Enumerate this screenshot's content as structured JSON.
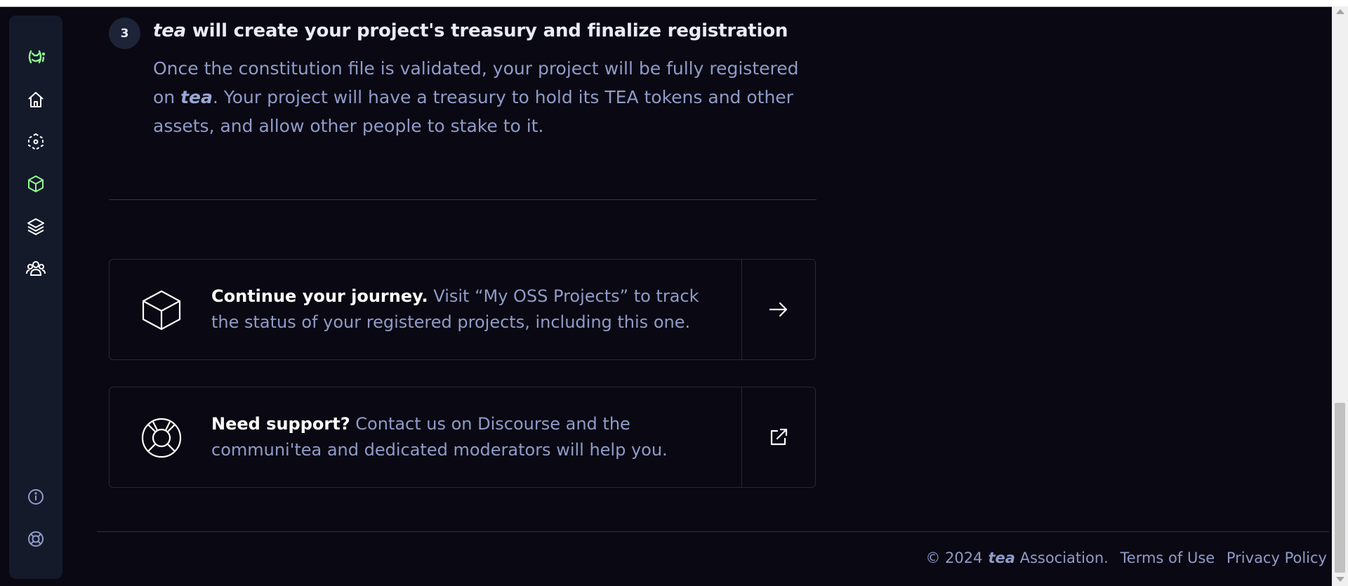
{
  "step": {
    "number": "3",
    "title_brand": "tea",
    "title_rest": " will create your project's treasury and finalize registration",
    "body_part1": "Once the constitution file is validated, your project will be fully registered on ",
    "body_brand": "tea",
    "body_part2": ". Your project will have a treasury to hold its TEA tokens and other assets, and allow other people to stake to it."
  },
  "cards": [
    {
      "icon": "cube-icon",
      "title": "Continue your journey.",
      "text": " Visit “My OSS Projects” to track the status of your registered projects, including this one.",
      "action_icon": "arrow-right-icon"
    },
    {
      "icon": "lifebuoy-icon",
      "title": "Need support?",
      "text": " Contact us on Discourse and the communi'tea and dedicated moderators will help you.",
      "action_icon": "external-link-icon"
    }
  ],
  "sidebar": {
    "items": [
      "logo-icon",
      "home-icon",
      "network-icon",
      "projects-icon",
      "layers-icon",
      "community-icon"
    ],
    "bottom": [
      "info-icon",
      "support-icon"
    ],
    "accent": "#8ff88f"
  },
  "footer": {
    "copyright": "© 2024",
    "brand": "tea",
    "association": " Association.",
    "terms": "Terms of Use",
    "privacy": "Privacy Policy"
  }
}
